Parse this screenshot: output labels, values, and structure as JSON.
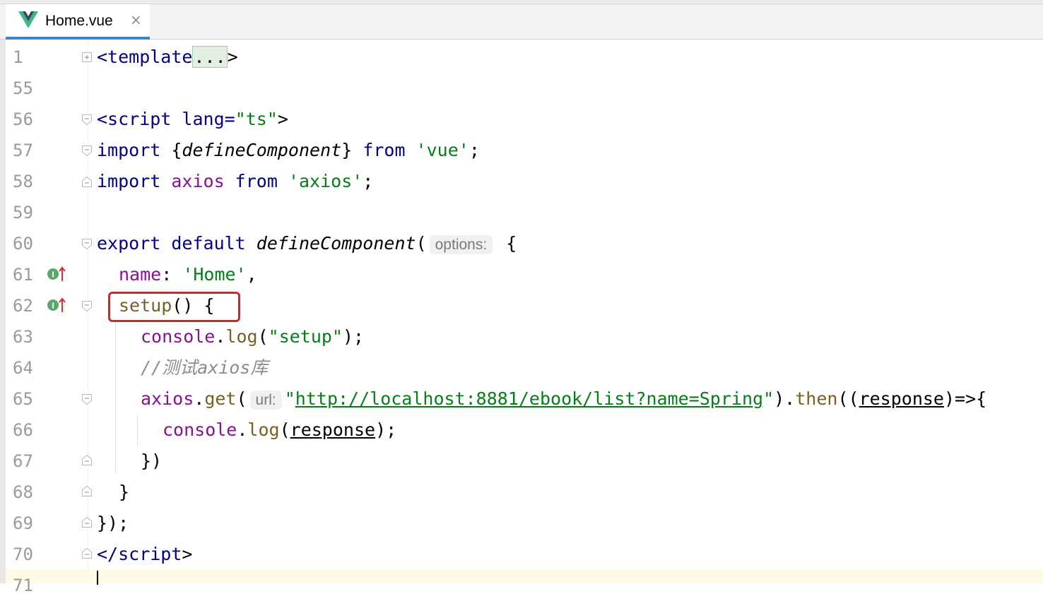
{
  "tab": {
    "title": "Home.vue",
    "close": "×",
    "icon": "vue-logo-icon"
  },
  "colors": {
    "keyword": "#000080",
    "string": "#067d17",
    "property": "#871094",
    "comment": "#8c8c8c",
    "highlight_box": "#e02020"
  },
  "line_numbers": [
    "1",
    "55",
    "56",
    "57",
    "58",
    "59",
    "60",
    "61",
    "62",
    "63",
    "64",
    "65",
    "66",
    "67",
    "68",
    "69",
    "70",
    "71"
  ],
  "code": {
    "l1_open": "<template",
    "l1_fold": "...",
    "l1_close": ">",
    "l56_open": "<script ",
    "l56_attr": "lang=",
    "l56_val": "\"ts\"",
    "l56_close": ">",
    "l57_kw": "import ",
    "l57_brace_open": "{",
    "l57_name": "defineComponent",
    "l57_brace_close": "} ",
    "l57_from": "from ",
    "l57_str": "'vue'",
    "l57_semi": ";",
    "l58_kw": "import ",
    "l58_name": "axios ",
    "l58_from": "from ",
    "l58_str": "'axios'",
    "l58_semi": ";",
    "l60_kw": "export default ",
    "l60_fn": "defineComponent",
    "l60_paren": "(",
    "l60_hint": "options:",
    "l60_brace": " {",
    "l61_prop": "name",
    "l61_colon": ": ",
    "l61_str": "'Home'",
    "l61_comma": ",",
    "l62_fn": "setup",
    "l62_rest": "() {",
    "l63_obj": "console",
    "l63_dot": ".",
    "l63_meth": "log",
    "l63_open": "(",
    "l63_str": "\"setup\"",
    "l63_close": ");",
    "l64_comment": "//测试axios库",
    "l65_obj": "axios",
    "l65_dot": ".",
    "l65_meth": "get",
    "l65_open": "(",
    "l65_hint": "url:",
    "l65_q1": "\"",
    "l65_url": "http://localhost:8881/ebook/list?name=Spring",
    "l65_q2": "\"",
    "l65_mid": ").",
    "l65_then": "then",
    "l65_p": "((",
    "l65_arg": "response",
    "l65_end": ")=>{",
    "l66_obj": "console",
    "l66_dot": ".",
    "l66_meth": "log",
    "l66_open": "(",
    "l66_arg": "response",
    "l66_close": ");",
    "l67": "})",
    "l68": "}",
    "l69": "});",
    "l70_open": "</script",
    "l70_close": ">"
  },
  "gutter_markers": {
    "l61": "implementing-method-icon",
    "l62": "implementing-method-icon"
  }
}
